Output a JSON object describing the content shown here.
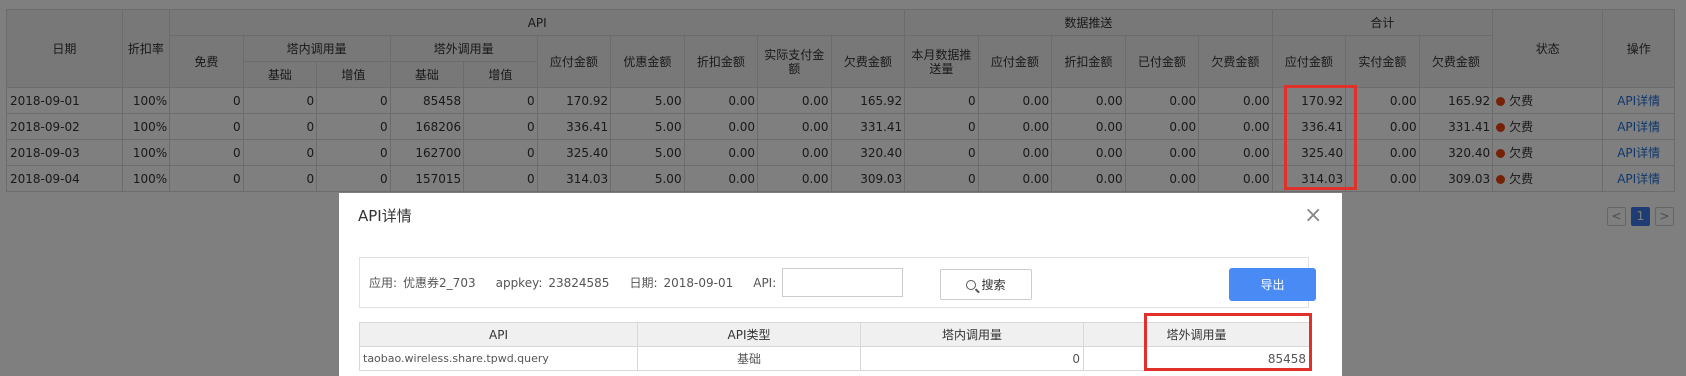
{
  "main_table": {
    "headers": {
      "date": "日期",
      "discount_rate": "折扣率",
      "group_api": "API",
      "group_push": "数据推送",
      "group_total": "合计",
      "status": "状态",
      "operation": "操作",
      "free": "免费",
      "inner_calls": "塔内调用量",
      "outer_calls": "塔外调用量",
      "basic": "基础",
      "added": "增值",
      "payable": "应付金额",
      "coupon": "优惠金额",
      "deduction": "折扣金额",
      "actual_paid": "实际支付金额",
      "owed": "欠费金额",
      "month_push": "本月数据推送量",
      "push_payable": "应付金额",
      "push_deduction": "折扣金额",
      "push_paid": "已付金额",
      "push_owed": "欠费金额",
      "total_payable": "应付金额",
      "total_actual": "实付金额",
      "total_owed": "欠费金额"
    },
    "rows": [
      {
        "date": "2018-09-01",
        "rate": "100%",
        "free": "0",
        "in_basic": "0",
        "in_added": "0",
        "out_basic": "85458",
        "out_added": "0",
        "payable": "170.92",
        "coupon": "5.00",
        "deduction": "0.00",
        "actual": "0.00",
        "owed": "165.92",
        "push": "0",
        "p_payable": "0.00",
        "p_deduction": "0.00",
        "p_paid": "0.00",
        "p_owed": "0.00",
        "t_payable": "170.92",
        "t_actual": "0.00",
        "t_owed": "165.92",
        "status": "欠费",
        "op": "API详情"
      },
      {
        "date": "2018-09-02",
        "rate": "100%",
        "free": "0",
        "in_basic": "0",
        "in_added": "0",
        "out_basic": "168206",
        "out_added": "0",
        "payable": "336.41",
        "coupon": "5.00",
        "deduction": "0.00",
        "actual": "0.00",
        "owed": "331.41",
        "push": "0",
        "p_payable": "0.00",
        "p_deduction": "0.00",
        "p_paid": "0.00",
        "p_owed": "0.00",
        "t_payable": "336.41",
        "t_actual": "0.00",
        "t_owed": "331.41",
        "status": "欠费",
        "op": "API详情"
      },
      {
        "date": "2018-09-03",
        "rate": "100%",
        "free": "0",
        "in_basic": "0",
        "in_added": "0",
        "out_basic": "162700",
        "out_added": "0",
        "payable": "325.40",
        "coupon": "5.00",
        "deduction": "0.00",
        "actual": "0.00",
        "owed": "320.40",
        "push": "0",
        "p_payable": "0.00",
        "p_deduction": "0.00",
        "p_paid": "0.00",
        "p_owed": "0.00",
        "t_payable": "325.40",
        "t_actual": "0.00",
        "t_owed": "320.40",
        "status": "欠费",
        "op": "API详情"
      },
      {
        "date": "2018-09-04",
        "rate": "100%",
        "free": "0",
        "in_basic": "0",
        "in_added": "0",
        "out_basic": "157015",
        "out_added": "0",
        "payable": "314.03",
        "coupon": "5.00",
        "deduction": "0.00",
        "actual": "0.00",
        "owed": "309.03",
        "push": "0",
        "p_payable": "0.00",
        "p_deduction": "0.00",
        "p_paid": "0.00",
        "p_owed": "0.00",
        "t_payable": "314.03",
        "t_actual": "0.00",
        "t_owed": "309.03",
        "status": "欠费",
        "op": "API详情"
      }
    ]
  },
  "pager": {
    "prev": "<",
    "current": "1",
    "next": ">"
  },
  "modal": {
    "title": "API详情",
    "close_icon": "close-icon",
    "filter": {
      "app_label": "应用:",
      "app_value": "优惠券2_703",
      "appkey_label": "appkey:",
      "appkey_value": "23824585",
      "date_label": "日期:",
      "date_value": "2018-09-01",
      "api_label": "API:",
      "api_input_value": "",
      "search_button": "搜索",
      "export_button": "导出"
    },
    "detail_table": {
      "headers": [
        "API",
        "API类型",
        "塔内调用量",
        "塔外调用量"
      ],
      "rows": [
        {
          "api": "taobao.wireless.share.tpwd.query",
          "type": "基础",
          "inner": "0",
          "outer": "85458"
        }
      ]
    }
  },
  "colors": {
    "highlight": "#e0302a",
    "link": "#1e6fd9",
    "status_dot": "#e8430c",
    "export_button": "#4a8af4"
  }
}
